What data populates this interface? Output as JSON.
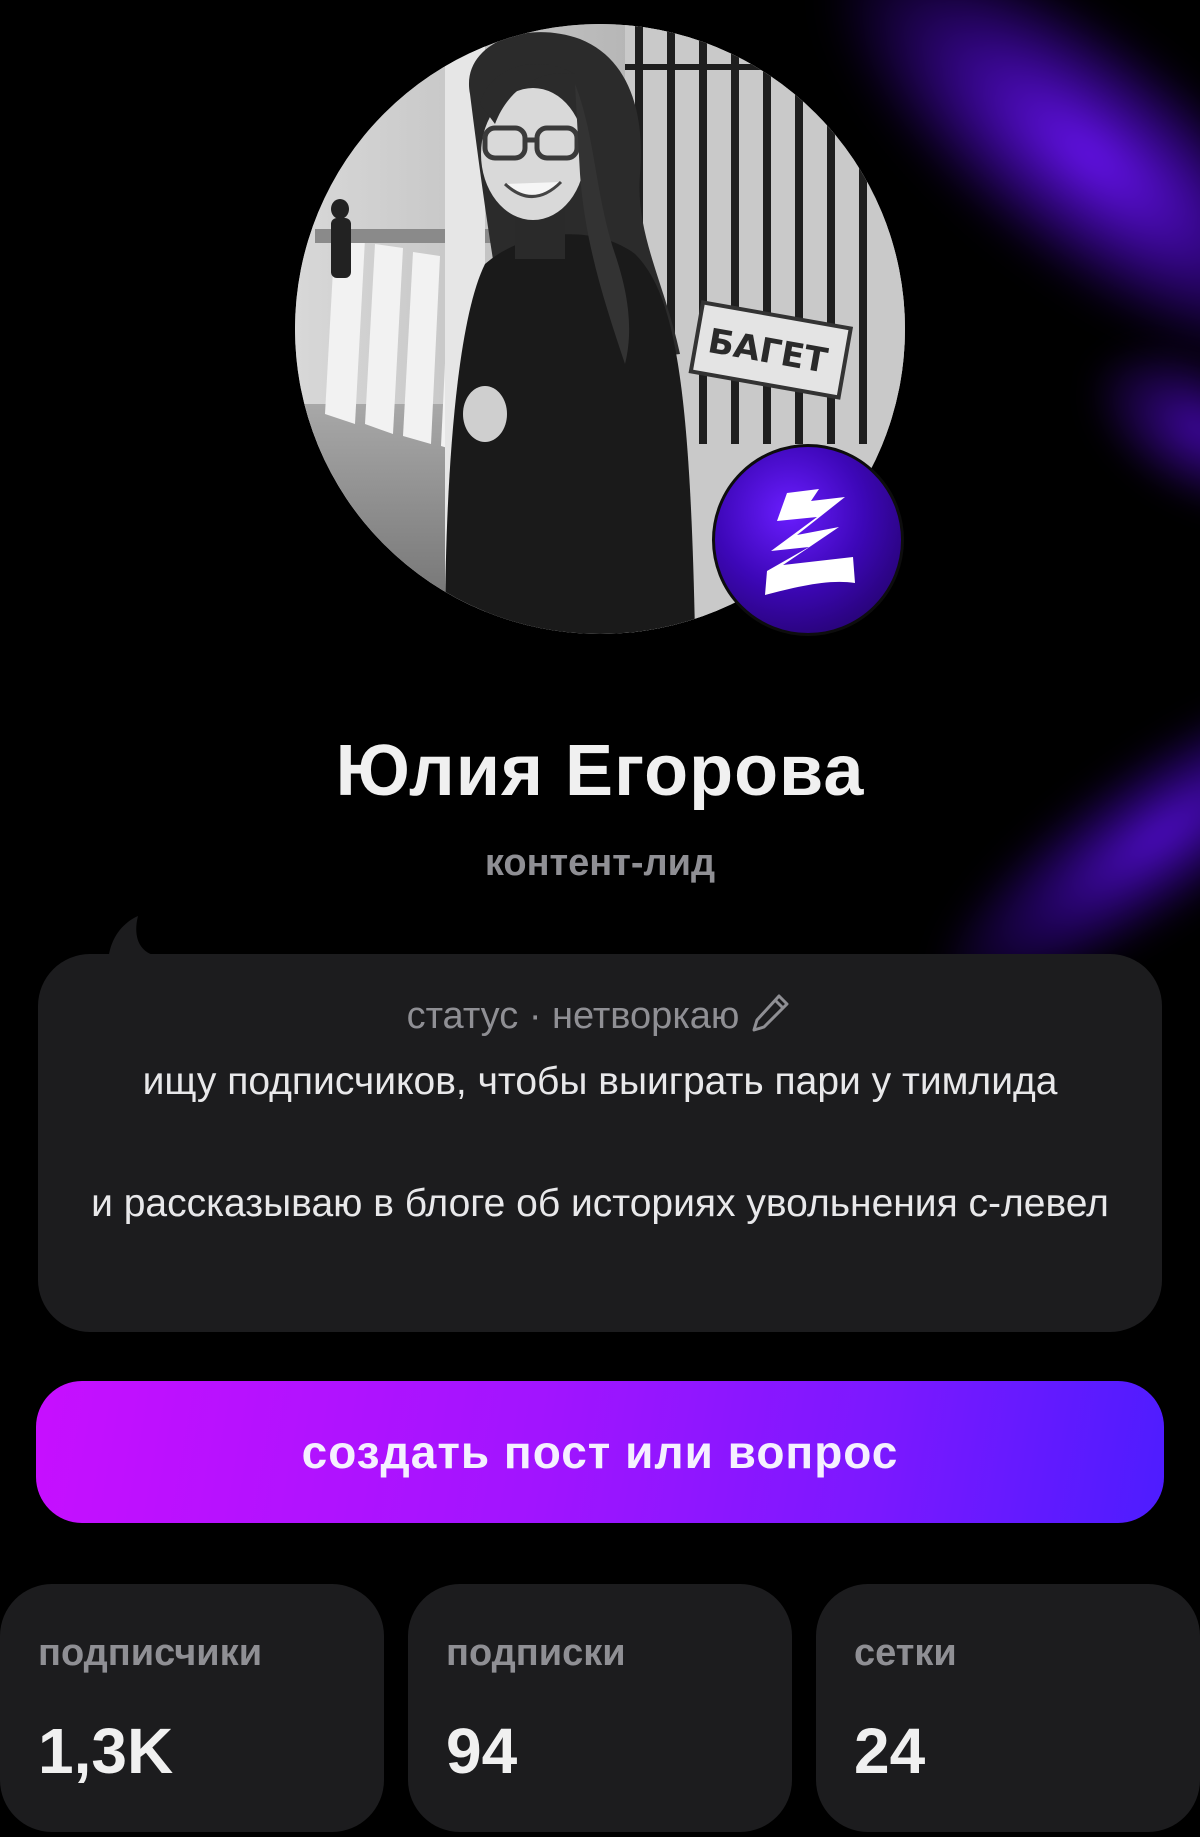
{
  "profile": {
    "name": "Юлия Егорова",
    "role": "контент-лид"
  },
  "status": {
    "header": "статус · нетворкаю",
    "line1": "ищу подписчиков, чтобы выиграть пари у тимлида",
    "line2": "и рассказываю в блоге об историях увольнения с-левел",
    "edit_icon": "pencil-icon"
  },
  "actions": {
    "create_label": "создать пост или вопрос"
  },
  "stats": [
    {
      "label": "подписчики",
      "value": "1,3K"
    },
    {
      "label": "подписки",
      "value": "94"
    },
    {
      "label": "сетки",
      "value": "24"
    }
  ],
  "colors": {
    "background": "#000000",
    "card": "#1c1c1e",
    "muted_text": "#8f8f94",
    "accent_start": "#c70fff",
    "accent_end": "#4d1cff"
  },
  "badge": {
    "icon": "brand-logo-icon"
  },
  "photo_sign_text": "БАГЕТ"
}
